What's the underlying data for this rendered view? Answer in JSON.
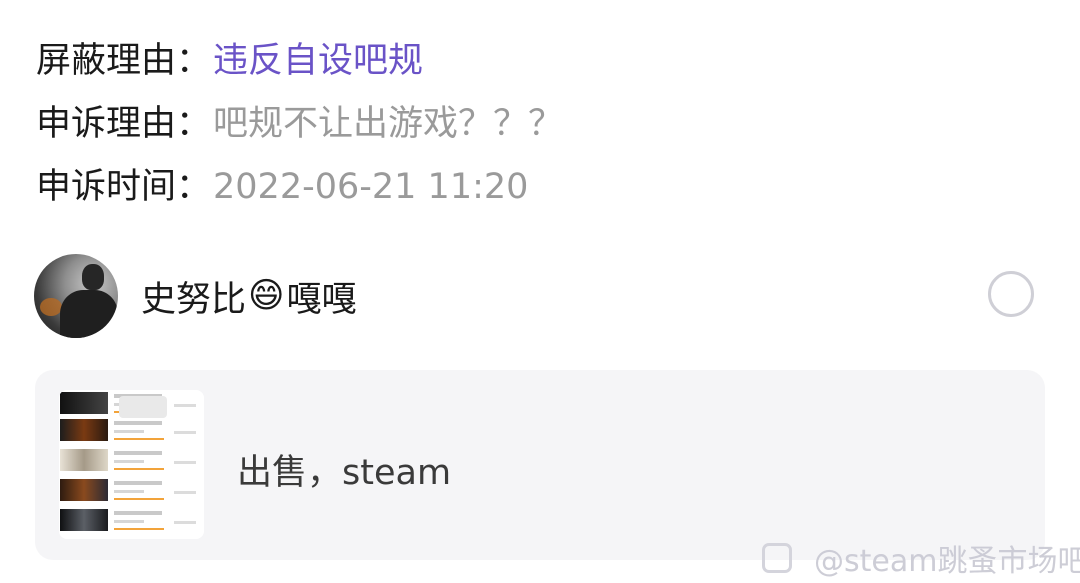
{
  "details": {
    "block_reason_label": "屏蔽理由：",
    "block_reason_value": "违反自设吧规",
    "appeal_reason_label": "申诉理由：",
    "appeal_reason_value": "吧规不让出游戏？？？",
    "appeal_time_label": "申诉时间：",
    "appeal_time_value": "2022-06-21 11:20"
  },
  "user": {
    "name_part1": "史努比",
    "emoji": "😄",
    "name_part2": "嘎嘎"
  },
  "post": {
    "text": "出售，steam"
  },
  "watermark": {
    "text": "@steam跳蚤市场吧"
  },
  "colors": {
    "accent_purple": "#6a53c7",
    "label_text": "#1a1a1a",
    "value_gray": "#9a9a9a",
    "card_bg": "#f5f5f7"
  },
  "icons": {
    "select": "radio-circle-icon",
    "watermark": "tieba-logo-icon"
  }
}
